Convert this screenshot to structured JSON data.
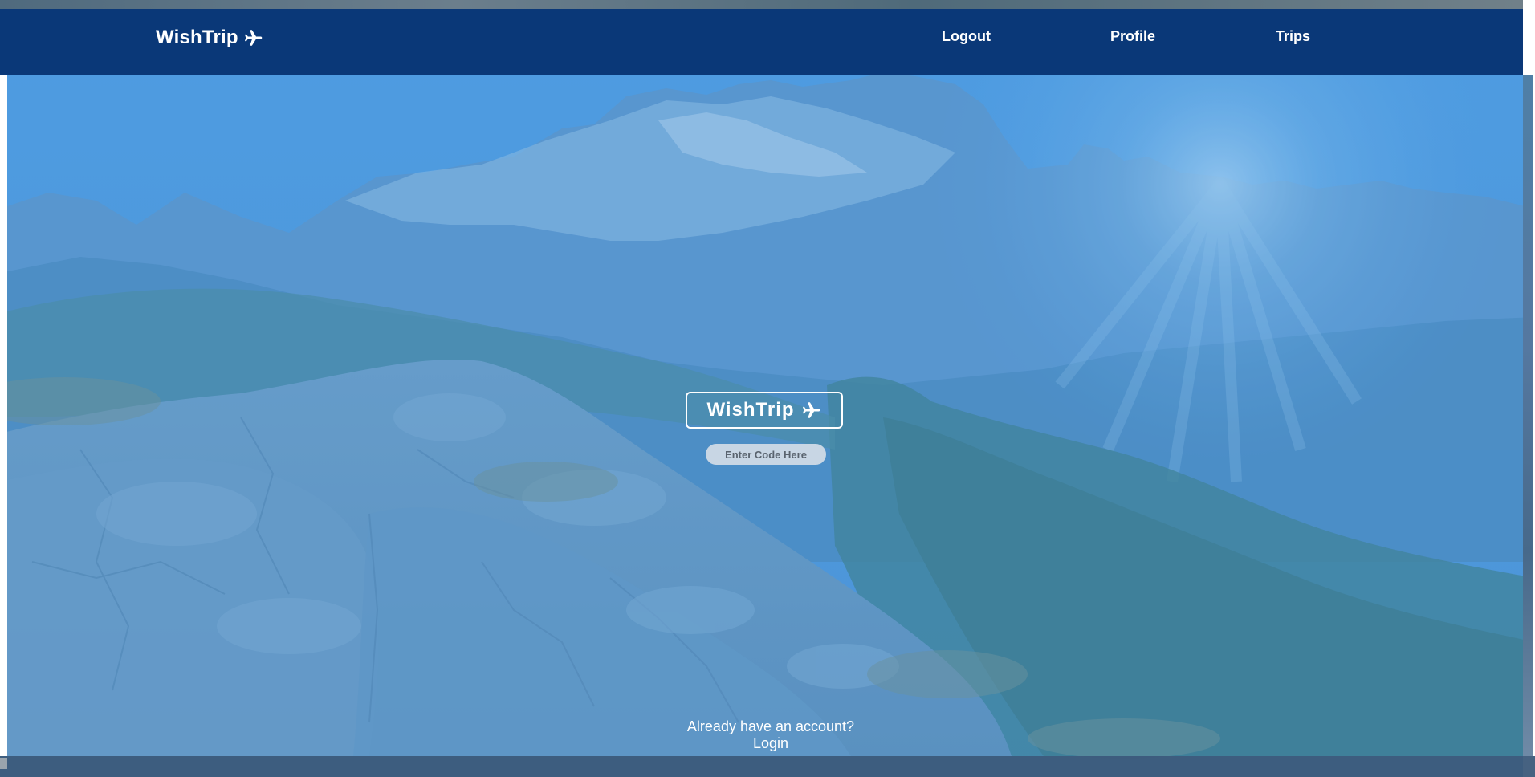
{
  "navbar": {
    "brand": "WishTrip",
    "brand_icon": "airplane-icon",
    "links": [
      {
        "label": "Logout"
      },
      {
        "label": "Profile"
      },
      {
        "label": "Trips"
      }
    ],
    "background_color": "#0a3878"
  },
  "hero": {
    "logo_text": "WishTrip",
    "logo_icon": "airplane-icon",
    "code_input": {
      "value": "",
      "placeholder": "Enter Code Here"
    },
    "overlay_color": "#4f9be0"
  },
  "footer": {
    "account_prompt": "Already have an account?",
    "login_label": "Login"
  }
}
